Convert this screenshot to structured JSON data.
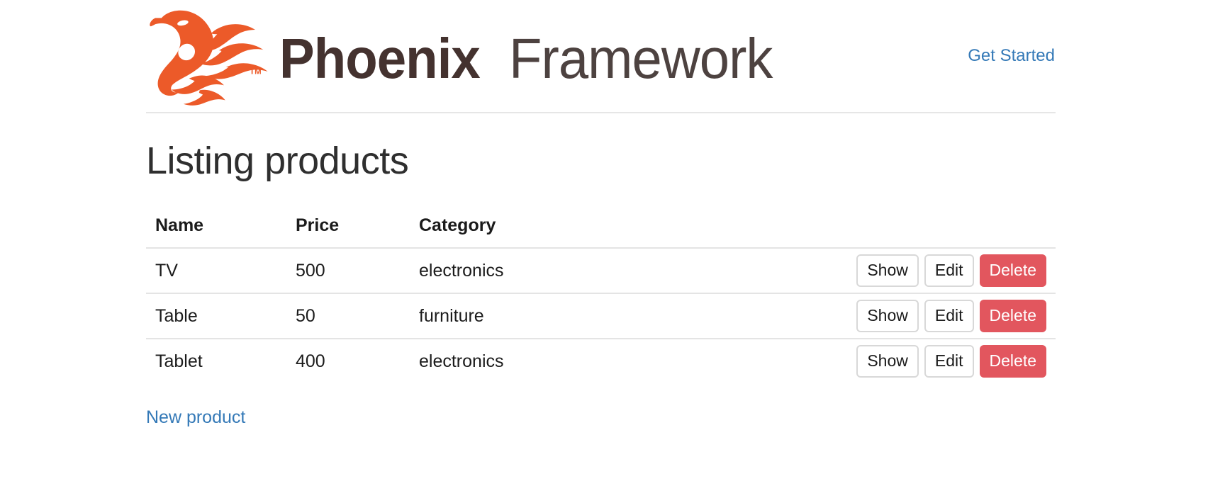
{
  "header": {
    "logo_icon": "phoenix-bird-logo",
    "logo_color": "#ec5a29",
    "wordmark_bold": "Phoenix",
    "wordmark_light": "Framework",
    "wordmark_color": "#44322f",
    "trademark": "TM",
    "nav": {
      "get_started_label": "Get Started",
      "link_color": "#3479b7"
    }
  },
  "main": {
    "page_title": "Listing products",
    "table": {
      "columns": [
        "Name",
        "Price",
        "Category"
      ],
      "rows": [
        {
          "name": "TV",
          "price": "500",
          "category": "electronics"
        },
        {
          "name": "Table",
          "price": "50",
          "category": "furniture"
        },
        {
          "name": "Tablet",
          "price": "400",
          "category": "electronics"
        }
      ],
      "actions": {
        "show_label": "Show",
        "edit_label": "Edit",
        "delete_label": "Delete",
        "delete_color": "#e2565e"
      }
    },
    "new_product_label": "New product"
  }
}
